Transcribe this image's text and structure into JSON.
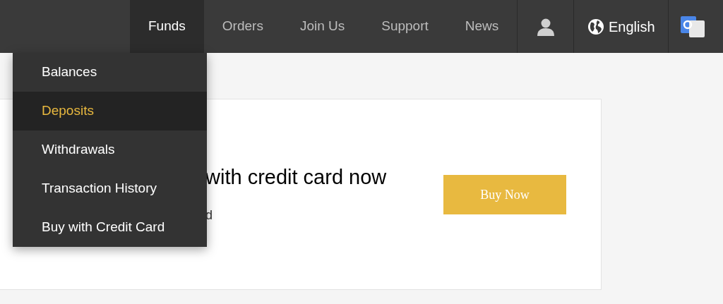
{
  "nav": {
    "items": [
      {
        "label": "Funds",
        "selected": true
      },
      {
        "label": "Orders",
        "selected": false
      },
      {
        "label": "Join Us",
        "selected": false
      },
      {
        "label": "Support",
        "selected": false
      },
      {
        "label": "News",
        "selected": false
      }
    ],
    "language": "English"
  },
  "dropdown": {
    "items": [
      {
        "label": "Balances",
        "selected": false
      },
      {
        "label": "Deposits",
        "selected": true
      },
      {
        "label": "Withdrawals",
        "selected": false
      },
      {
        "label": "Transaction History",
        "selected": false
      },
      {
        "label": "Buy with Credit Card",
        "selected": false
      }
    ]
  },
  "card": {
    "heading": "with credit card now",
    "subtext": "d",
    "button": "Buy Now"
  }
}
